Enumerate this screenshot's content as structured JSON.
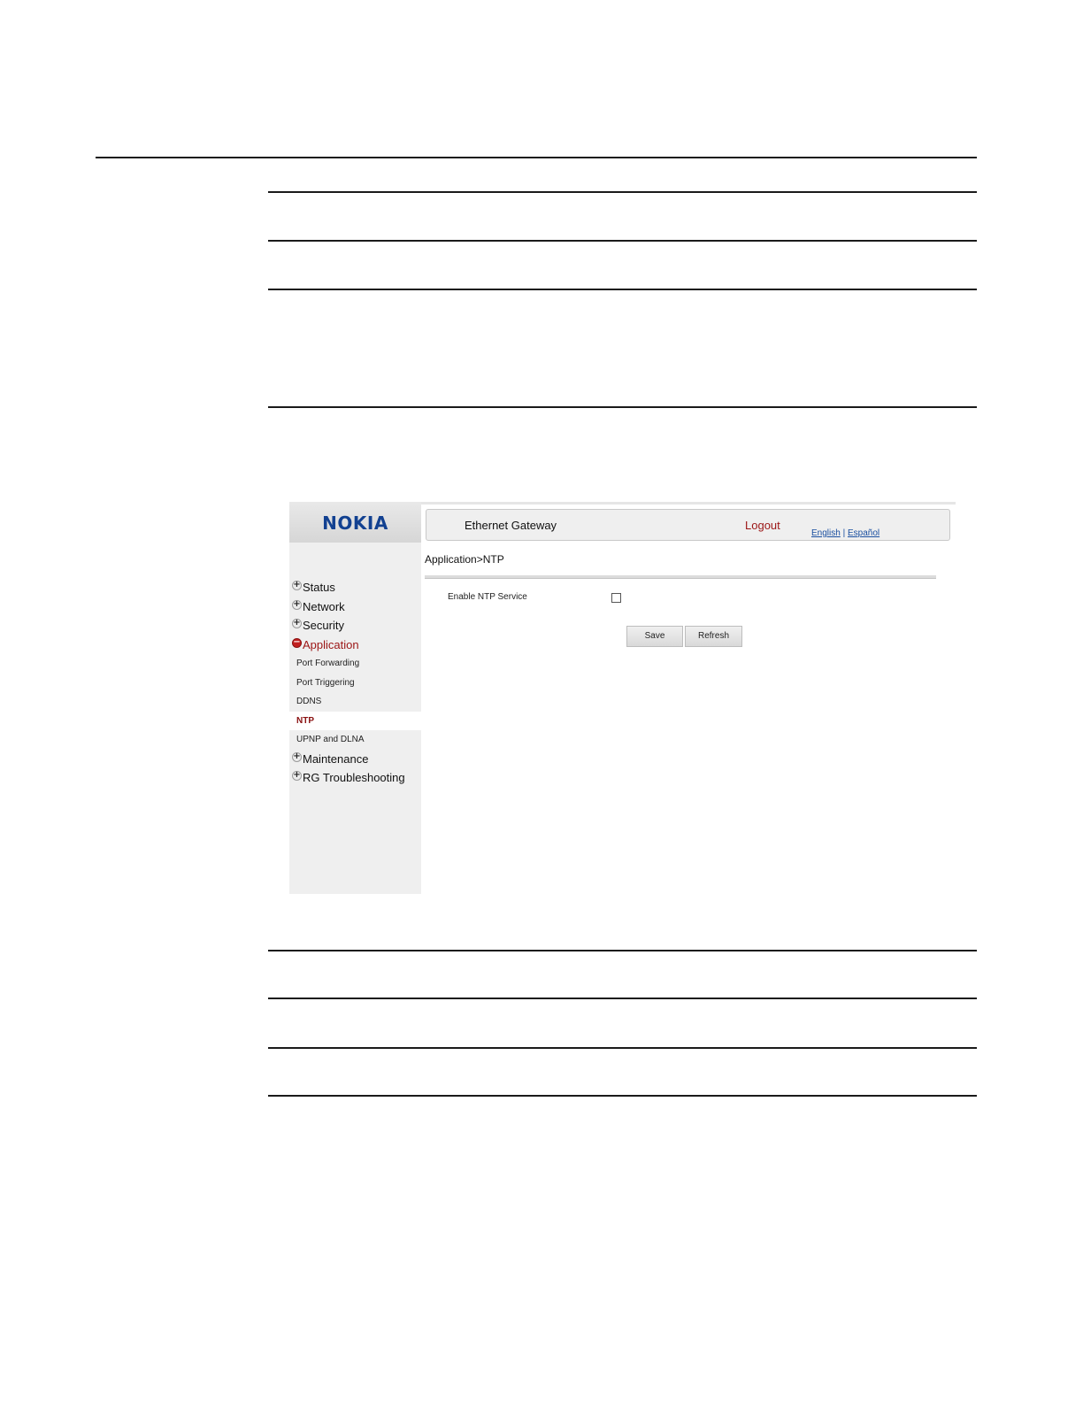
{
  "header": {
    "logo": "NOKIA",
    "title": "Ethernet Gateway",
    "logout": "Logout",
    "lang_english": "English",
    "lang_separator": "|",
    "lang_espanol": "Español"
  },
  "breadcrumb": "Application>NTP",
  "sidebar": {
    "items": [
      {
        "label": "Status",
        "toggle": "+"
      },
      {
        "label": "Network",
        "toggle": "+"
      },
      {
        "label": "Security",
        "toggle": "+"
      },
      {
        "label": "Application",
        "toggle": "−",
        "open": true
      },
      {
        "label": "Port Forwarding"
      },
      {
        "label": "Port Triggering"
      },
      {
        "label": "DDNS"
      },
      {
        "label": "NTP",
        "active": true
      },
      {
        "label": "UPNP and DLNA"
      },
      {
        "label": "Maintenance",
        "toggle": "+"
      },
      {
        "label": "RG Troubleshooting",
        "toggle": "+"
      }
    ]
  },
  "form": {
    "enable_ntp_label": "Enable NTP Service",
    "enable_ntp_checked": false,
    "save_label": "Save",
    "refresh_label": "Refresh"
  },
  "colors": {
    "brand": "#124191",
    "accent_red": "#9b1515",
    "link_blue": "#1a4fa0",
    "sidebar_bg": "#efefef"
  }
}
